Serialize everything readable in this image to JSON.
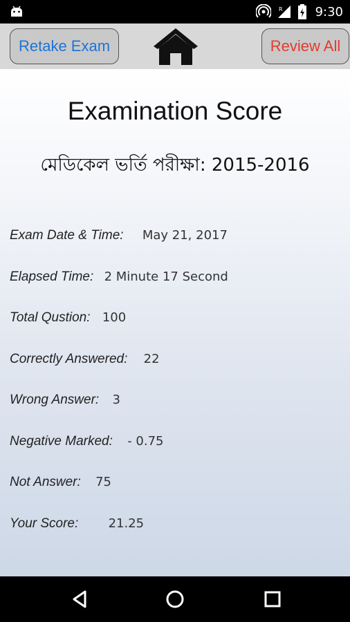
{
  "status_bar": {
    "time": "9:30",
    "icons": [
      "android-debug-icon",
      "hotspot-icon",
      "signal-icon",
      "battery-icon"
    ]
  },
  "toolbar": {
    "retake_label": "Retake Exam",
    "review_label": "Review All",
    "home_icon": "home-icon",
    "colors": {
      "retake_text": "#1e73d6",
      "review_text": "#e33b2d"
    }
  },
  "main": {
    "title": "Examination Score",
    "subtitle": "মেডিকেল ভর্তি পরীক্ষা: 2015-2016",
    "details": [
      {
        "label": "Exam Date & Time:",
        "value": "May 21, 2017"
      },
      {
        "label": "Elapsed Time:",
        "value": "2 Minute 17 Second"
      },
      {
        "label": "Total Qustion:",
        "value": "100"
      },
      {
        "label": "Correctly Answered:",
        "value": "22"
      },
      {
        "label": "Wrong Answer:",
        "value": "3"
      },
      {
        "label": "Negative Marked:",
        "value": "- 0.75"
      },
      {
        "label": "Not Answer:",
        "value": "75"
      },
      {
        "label": "Your Score:",
        "value": "21.25"
      }
    ]
  },
  "nav_bar": {
    "items": [
      "back-icon",
      "home-circle-icon",
      "recents-icon"
    ]
  }
}
